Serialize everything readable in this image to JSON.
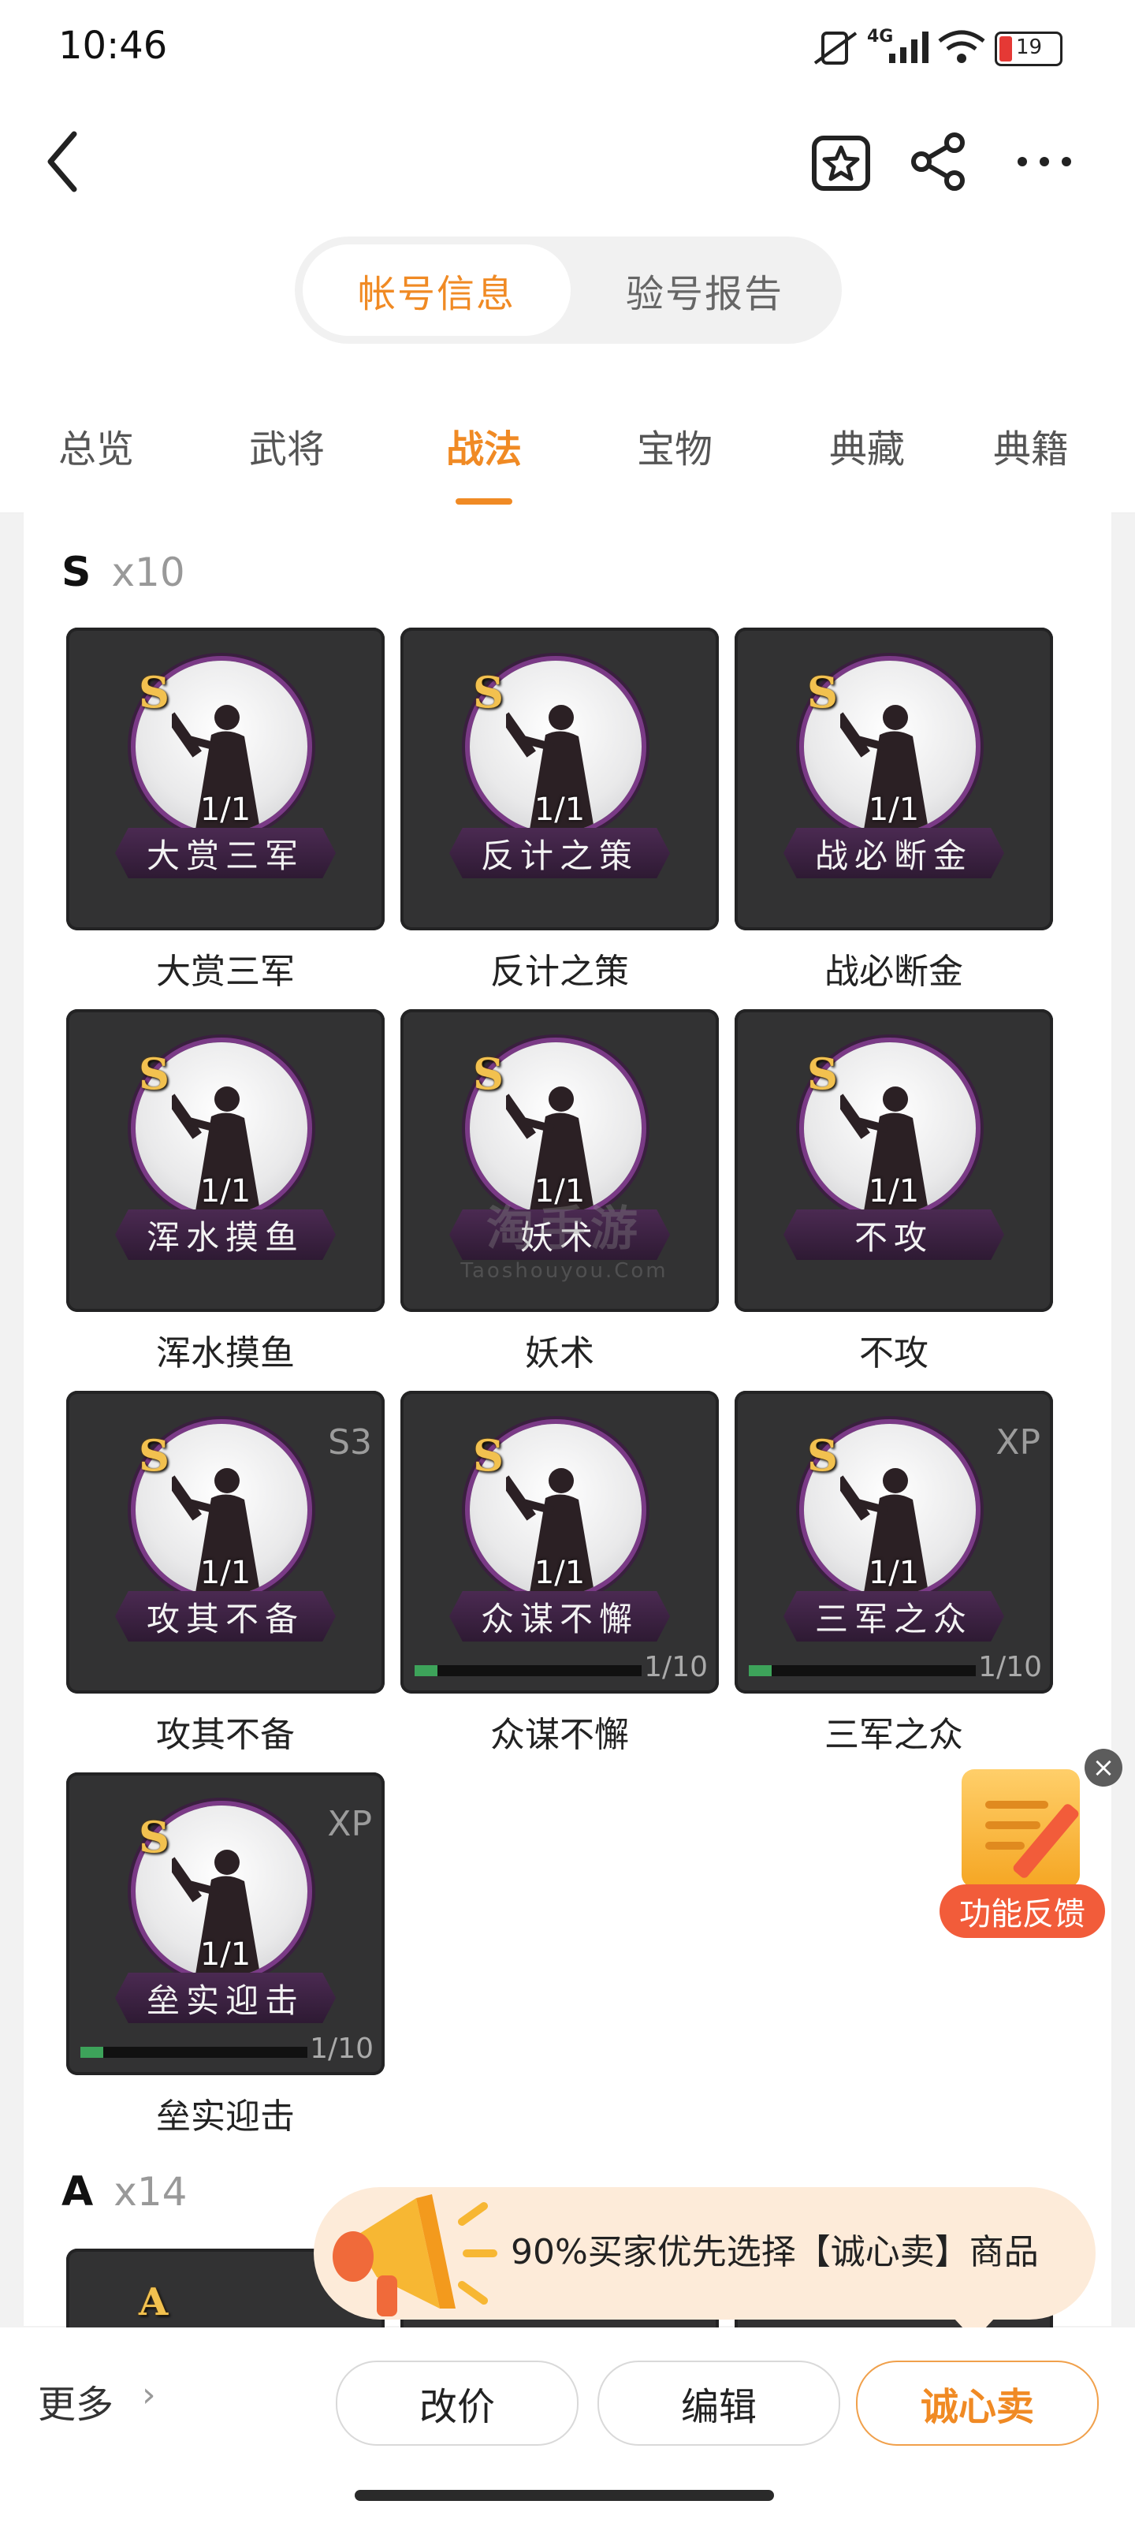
{
  "status_bar": {
    "time": "10:46",
    "network": "4G",
    "battery": "19"
  },
  "header": {
    "segments": [
      "帐号信息",
      "验号报告"
    ],
    "active_segment": 0
  },
  "tabs": [
    "总览",
    "武将",
    "战法",
    "宝物",
    "典藏",
    "典籍"
  ],
  "active_tab": 2,
  "sections": [
    {
      "grade": "S",
      "count": "x10"
    },
    {
      "grade": "A",
      "count": "x14"
    }
  ],
  "skills": [
    {
      "name": "大赏三军",
      "banner": "大赏三军",
      "grade": "S",
      "fraction": "1/1",
      "tag": "",
      "progress": "",
      "progress_ratio": 0
    },
    {
      "name": "反计之策",
      "banner": "反计之策",
      "grade": "S",
      "fraction": "1/1",
      "tag": "",
      "progress": "",
      "progress_ratio": 0
    },
    {
      "name": "战必断金",
      "banner": "战必断金",
      "grade": "S",
      "fraction": "1/1",
      "tag": "",
      "progress": "",
      "progress_ratio": 0
    },
    {
      "name": "浑水摸鱼",
      "banner": "浑水摸鱼",
      "grade": "S",
      "fraction": "1/1",
      "tag": "",
      "progress": "",
      "progress_ratio": 0
    },
    {
      "name": "妖术",
      "banner": "妖术",
      "grade": "S",
      "fraction": "1/1",
      "tag": "",
      "progress": "",
      "progress_ratio": 0
    },
    {
      "name": "不攻",
      "banner": "不攻",
      "grade": "S",
      "fraction": "1/1",
      "tag": "",
      "progress": "",
      "progress_ratio": 0
    },
    {
      "name": "攻其不备",
      "banner": "攻其不备",
      "grade": "S",
      "fraction": "1/1",
      "tag": "S3",
      "progress": "",
      "progress_ratio": 0
    },
    {
      "name": "众谋不懈",
      "banner": "众谋不懈",
      "grade": "S",
      "fraction": "1/1",
      "tag": "",
      "progress": "1/10",
      "progress_ratio": 0.1
    },
    {
      "name": "三军之众",
      "banner": "三军之众",
      "grade": "S",
      "fraction": "1/1",
      "tag": "XP",
      "progress": "1/10",
      "progress_ratio": 0.1
    },
    {
      "name": "垒实迎击",
      "banner": "垒实迎击",
      "grade": "S",
      "fraction": "1/1",
      "tag": "XP",
      "progress": "1/10",
      "progress_ratio": 0.1
    }
  ],
  "watermark": {
    "main": "淘手游",
    "sub": "Taoshouyou.Com"
  },
  "feedback": {
    "label": "功能反馈",
    "close": "×"
  },
  "promo": {
    "text": "90%买家优先选择【诚心卖】商品"
  },
  "bottom_bar": {
    "more": "更多",
    "buttons": [
      "改价",
      "编辑",
      "诚心卖"
    ]
  },
  "icons": [
    "back-icon",
    "favorite-icon",
    "share-icon",
    "more-icon",
    "chevron-right-icon",
    "megaphone-icon",
    "close-icon"
  ],
  "colors": {
    "accent": "#f08a24",
    "card_bg": "#323233",
    "progress_fill": "#3da35a",
    "feedback_label": "#f25c3a",
    "promo_bg": "#fdebd9"
  }
}
